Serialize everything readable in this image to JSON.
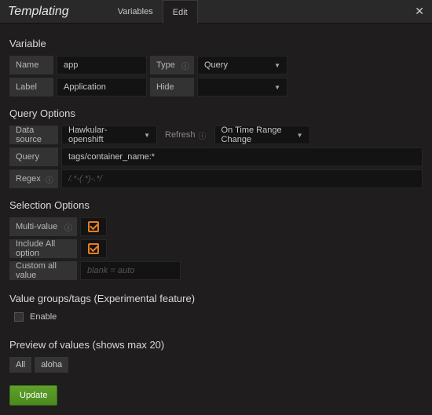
{
  "header": {
    "title": "Templating",
    "tabs": [
      "Variables",
      "Edit"
    ],
    "active_tab_index": 1
  },
  "variable": {
    "section": "Variable",
    "name_label": "Name",
    "name_value": "app",
    "type_label": "Type",
    "type_value": "Query",
    "label_label": "Label",
    "label_value": "Application",
    "hide_label": "Hide",
    "hide_value": ""
  },
  "query_options": {
    "section": "Query Options",
    "datasource_label": "Data source",
    "datasource_value": "Hawkular-openshift",
    "refresh_label": "Refresh",
    "refresh_value": "On Time Range Change",
    "query_label": "Query",
    "query_value": "tags/container_name:*",
    "regex_label": "Regex",
    "regex_placeholder": "/.*-(.*)-.*/"
  },
  "selection": {
    "section": "Selection Options",
    "multi_label": "Multi-value",
    "multi_checked": true,
    "include_all_label": "Include All option",
    "include_all_checked": true,
    "custom_all_label": "Custom all value",
    "custom_all_placeholder": "blank = auto"
  },
  "groups": {
    "section": "Value groups/tags (Experimental feature)",
    "enable_label": "Enable",
    "enabled": false
  },
  "preview": {
    "section": "Preview of values (shows max 20)",
    "values": [
      "All",
      "aloha"
    ]
  },
  "actions": {
    "update": "Update"
  }
}
